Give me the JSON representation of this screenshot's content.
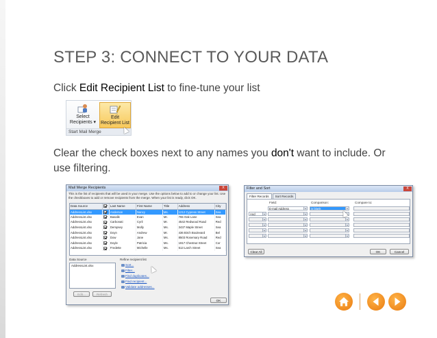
{
  "slide": {
    "title": "STEP 3: CONNECT TO YOUR DATA",
    "line1_prefix": "Click ",
    "line1_highlight": "Edit Recipient List",
    "line1_suffix": " to fine-tune your list",
    "line2_prefix": "Clear the check boxes next to any names you ",
    "line2_highlight": "don't",
    "line2_suffix": " want to include. Or use filtering."
  },
  "ribbon": {
    "select_label_1": "Select",
    "select_label_2": "Recipients",
    "edit_label_1": "Edit",
    "edit_label_2": "Recipient List",
    "group_label": "Start Mail Merge"
  },
  "mail_merge": {
    "title": "Mail Merge Recipients",
    "close": "X",
    "description": "This is the list of recipients that will be used in your merge. Use the options below to add to or change your list. Use the checkboxes to add or remove recipients from the merge. When your list is ready, click OK.",
    "columns": [
      "Data Source",
      "",
      "Last Name",
      "First Name",
      "Title",
      "Address",
      "City"
    ],
    "rows": [
      {
        "source": "AddressList.xlsx",
        "last": "Anderson",
        "first": "Nancy",
        "title": "Ms.",
        "address": "1212 Cypress Street",
        "city": "Sea"
      },
      {
        "source": "AddressList.xlsx",
        "last": "Basalik",
        "first": "Evan",
        "title": "Mr.",
        "address": "765 Oak Lane",
        "city": "Sea"
      },
      {
        "source": "AddressList.xlsx",
        "last": "Carbonati",
        "first": "Cyril",
        "title": "Mr.",
        "address": "4542 Redwood Road",
        "city": "Red"
      },
      {
        "source": "AddressList.xlsx",
        "last": "Dempsey",
        "first": "Molly",
        "title": "Ms.",
        "address": "3437 Maple Street",
        "city": "Sea"
      },
      {
        "source": "AddressList.xlsx",
        "last": "Doyn",
        "first": "Andrew",
        "title": "Mr.",
        "address": "436 Birch Boulevard",
        "city": "Bel"
      },
      {
        "source": "AddressList.xlsx",
        "last": "Dow",
        "first": "Jane",
        "title": "Ms.",
        "address": "8503 Rosemary Road",
        "city": "Red"
      },
      {
        "source": "AddressList.xlsx",
        "last": "Doyle",
        "first": "Patricia",
        "title": "Ms.",
        "address": "1917 Chestnut Street",
        "city": "Cor"
      },
      {
        "source": "AddressList.xlsx",
        "last": "Fredette",
        "first": "Michelle",
        "title": "Ms.",
        "address": "513 Larch Street",
        "city": "Sea"
      }
    ],
    "data_source_label": "Data Source",
    "data_source_item": "AddressList.xlsx",
    "refine_label": "Refine recipient list",
    "links": [
      "Sort...",
      "Filter...",
      "Find duplicates...",
      "Find recipient...",
      "Validate addresses..."
    ],
    "edit_button": "Edit...",
    "refresh_button": "Refresh",
    "ok_button": "OK"
  },
  "filter_sort": {
    "title": "Filter and Sort",
    "close": "X",
    "tab_filter": "Filter Records",
    "tab_sort": "Sort Records",
    "field_header": "Field:",
    "comparison_header": "Comparison:",
    "compare_to_header": "Compare to:",
    "row1_field": "E-mail Address",
    "row1_comparison": "is blank",
    "row2_op": "And",
    "clear_all_button": "Clear All",
    "ok_button": "OK",
    "cancel_button": "Cancel"
  },
  "colors": {
    "accent": "#f39c12",
    "selection": "#3399ff",
    "title_text": "#5a5a5a"
  },
  "icons": {
    "home": "home-icon",
    "prev": "arrow-left-icon",
    "next": "arrow-right-icon"
  }
}
